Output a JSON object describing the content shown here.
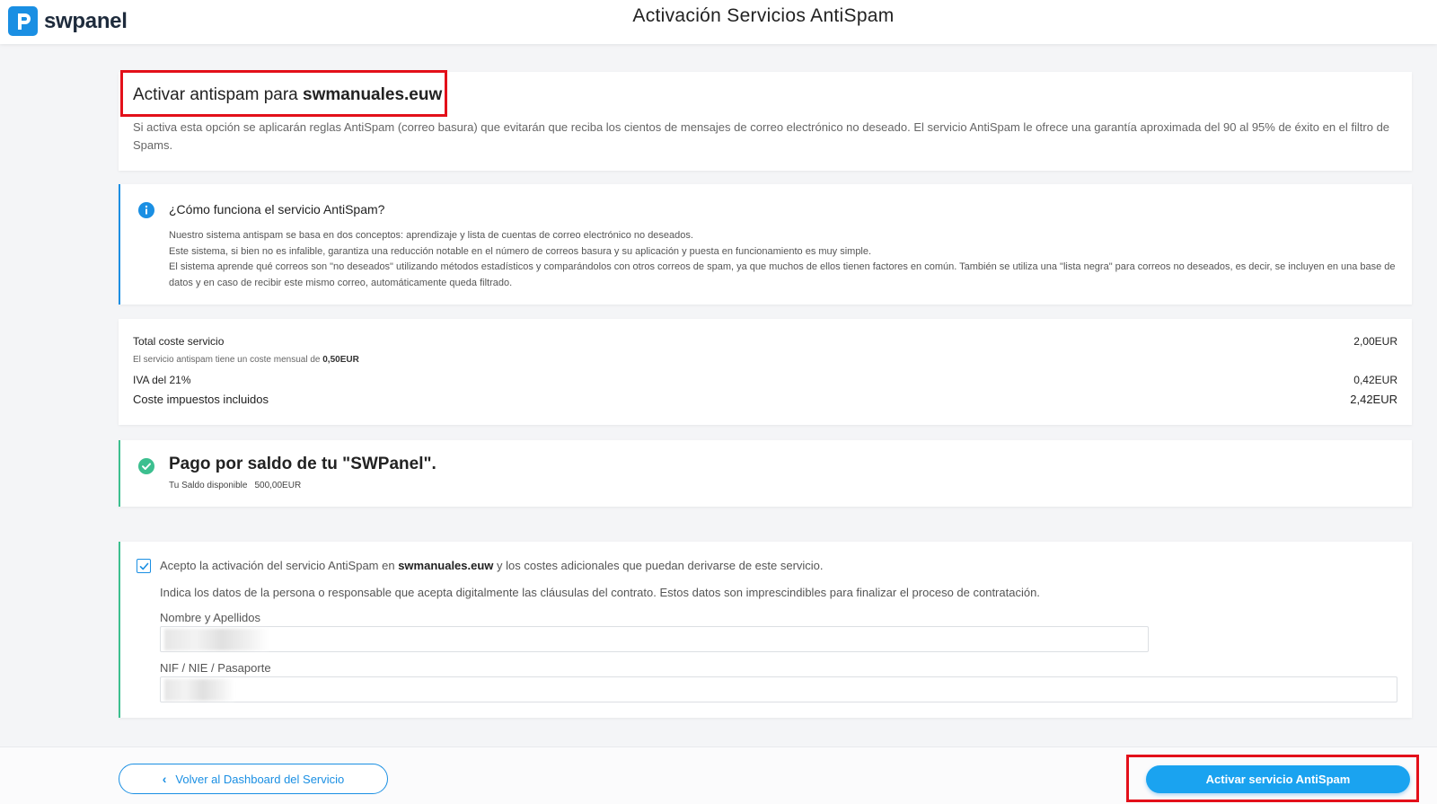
{
  "header": {
    "logo_text": "swpanel",
    "page_title": "Activación Servicios AntiSpam"
  },
  "intro": {
    "title_prefix": "Activar antispam para ",
    "domain": "swmanuales.euw",
    "description": "Si activa esta opción se aplicarán reglas AntiSpam (correo basura) que evitarán que reciba los cientos de mensajes de correo electrónico no deseado. El servicio AntiSpam le ofrece una garantía aproximada del 90 al 95% de éxito en el filtro de Spams."
  },
  "info": {
    "icon": "info-icon",
    "title": "¿Cómo funciona el servicio AntiSpam?",
    "lines": [
      "Nuestro sistema antispam se basa en dos conceptos: aprendizaje y lista de cuentas de correo electrónico no deseados.",
      "Este sistema, si bien no es infalible, garantiza una reducción notable en el número de correos basura y su aplicación y puesta en funcionamiento es muy simple.",
      "El sistema aprende qué correos son \"no deseados\" utilizando métodos estadísticos y comparándolos con otros correos de spam, ya que muchos de ellos tienen factores en común. También se utiliza una \"lista negra\" para correos no deseados, es decir, se incluyen en una base de datos y en caso de recibir este mismo correo, automáticamente queda filtrado."
    ]
  },
  "cost": {
    "total_label": "Total coste servicio",
    "total_value": "2,00EUR",
    "monthly_note_prefix": "El servicio antispam tiene un coste mensual de ",
    "monthly_value": "0,50EUR",
    "iva_label": "IVA del 21%",
    "iva_value": "0,42EUR",
    "tax_included_label": "Coste impuestos incluidos",
    "tax_included_value": "2,42EUR"
  },
  "payment": {
    "icon": "check-circle-icon",
    "title": "Pago por saldo de tu \"SWPanel\".",
    "balance_label": "Tu Saldo disponible",
    "balance_value": "500,00EUR"
  },
  "accept": {
    "checked": true,
    "text_prefix": "Acepto la activación del servicio AntiSpam en ",
    "domain": "swmanuales.euw",
    "text_suffix": " y los costes adicionales que puedan derivarse de este servicio.",
    "description": "Indica los datos de la persona o responsable que acepta digitalmente las cláusulas del contrato. Estos datos son imprescindibles para finalizar el proceso de contratación.",
    "name_label": "Nombre y Apellidos",
    "id_label": "NIF / NIE / Pasaporte"
  },
  "footer": {
    "back_label": "Volver al Dashboard del Servicio",
    "activate_label": "Activar servicio AntiSpam"
  },
  "colors": {
    "primary": "#1a8fe3",
    "success": "#3cbf8f",
    "highlight": "#e3101a"
  }
}
